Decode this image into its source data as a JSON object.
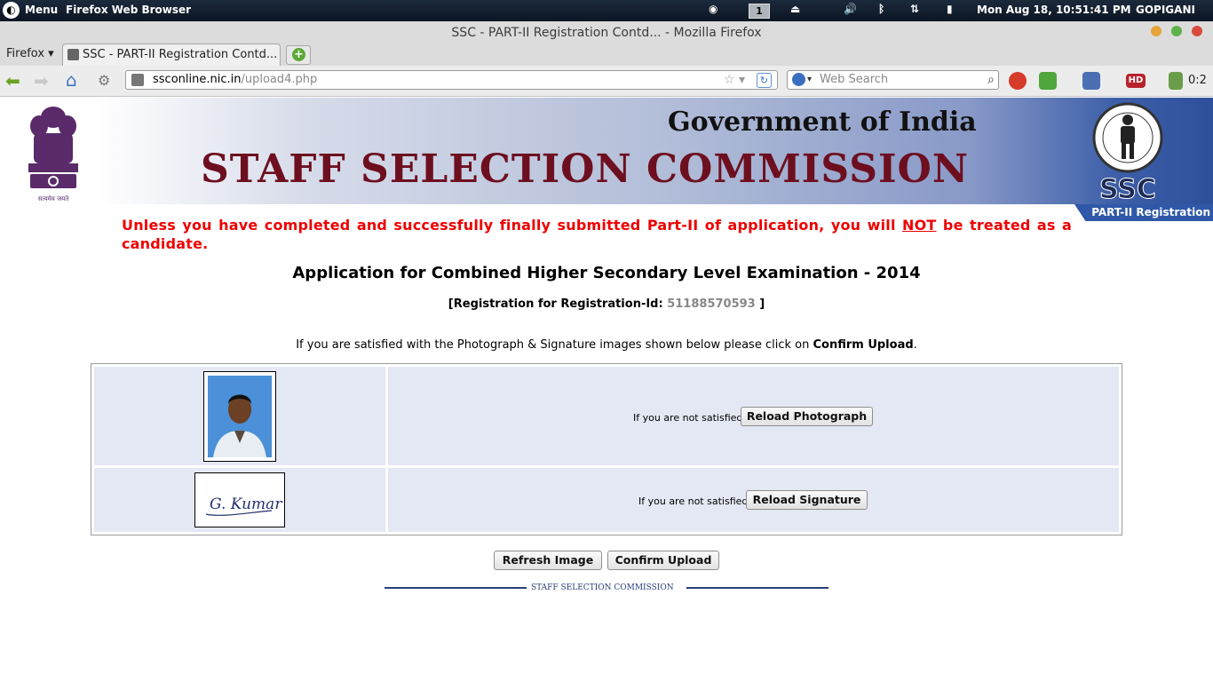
{
  "panel": {
    "menu_label": "Menu",
    "app_label": "Firefox Web Browser",
    "workspace": "1",
    "clock": "Mon Aug 18, 10:51:41 PM",
    "user": "GOPIGANI",
    "indicator_icons": [
      "steam-icon",
      "eject-icon",
      "volume-icon",
      "bluetooth-icon",
      "network-icon",
      "battery-icon"
    ]
  },
  "window": {
    "title": "SSC - PART-II Registration Contd... - Mozilla Firefox",
    "controls": {
      "minimize_color": "#e8a33a",
      "maximize_color": "#5fb24a",
      "close_color": "#d94c3d"
    }
  },
  "browser": {
    "firefox_menu": "Firefox ▾",
    "tab_title": "SSC - PART-II Registration Contd...",
    "url_host": "ssconline.nic.in",
    "url_path": "/upload4.php",
    "search_placeholder": "Web Search",
    "addon_count": "0:2"
  },
  "header": {
    "gov_title": "Government of India",
    "commission_title": "STAFF SELECTION COMMISSION",
    "logo_text": "SSC",
    "emblem_motto": "सत्यमेव जयते",
    "part_tag": "PART-II Registration"
  },
  "content": {
    "warning_before": "Unless you have completed and successfully finally submitted Part-II of application, you will ",
    "warning_not": "NOT",
    "warning_after": " be treated as a candidate.",
    "app_title": "Application for Combined Higher Secondary Level Examination - 2014",
    "reg_prefix": "[Registration for Registration-Id: ",
    "reg_id": "51188570593",
    "reg_suffix": " ]",
    "instruction_before": "If you are satisfied with the Photograph & Signature images shown below please click on ",
    "instruction_bold": "Confirm Upload",
    "instruction_after": "."
  },
  "uploads": {
    "photo_hint": "If you are not satisfied",
    "reload_photo": "Reload Photograph",
    "sig_hint": "If you are not satisfied",
    "reload_sig": "Reload Signature",
    "signature_text": "G. Kumar"
  },
  "actions": {
    "refresh": "Refresh Image",
    "confirm": "Confirm Upload"
  },
  "footer": {
    "text": "STAFF SELECTION COMMISSION"
  },
  "colors": {
    "warning": "#ee0000",
    "commission_title": "#6d0f1f",
    "part_tag_bg": "#2f58a8",
    "cell_bg": "#e4e8f4"
  }
}
